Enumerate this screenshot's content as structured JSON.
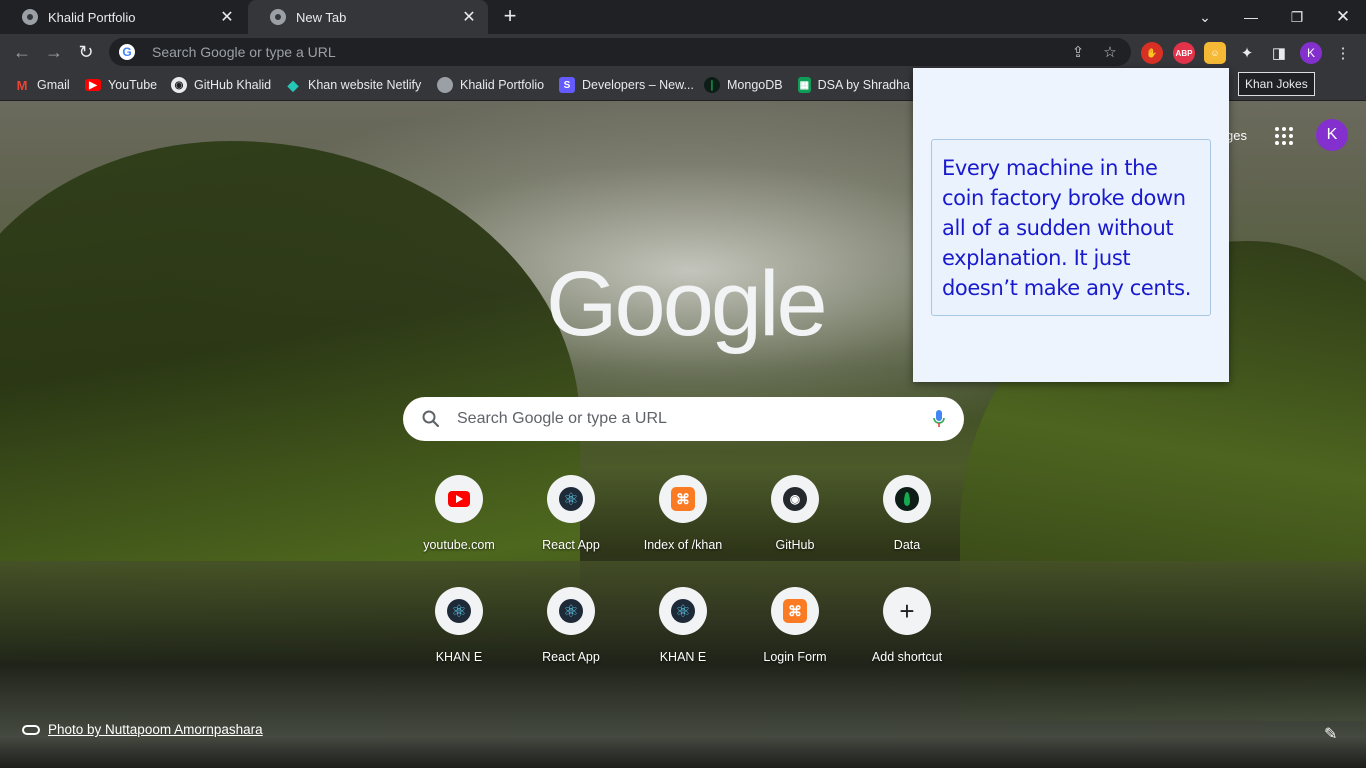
{
  "tabs": [
    {
      "title": "Khalid Portfolio",
      "active": false
    },
    {
      "title": "New Tab",
      "active": true
    }
  ],
  "omnibox": {
    "placeholder": "Search Google or type a URL"
  },
  "extensions": {
    "abp_label": "ABP",
    "profile_initial": "K",
    "hovered_tooltip": "Khan Jokes"
  },
  "bookmarks": [
    {
      "label": "Gmail",
      "icon": "gmail-icon"
    },
    {
      "label": "YouTube",
      "icon": "youtube-icon"
    },
    {
      "label": "GitHub Khalid",
      "icon": "github-icon"
    },
    {
      "label": "Khan website Netlify",
      "icon": "netlify-icon"
    },
    {
      "label": "Khalid Portfolio",
      "icon": "globe-icon"
    },
    {
      "label": "Developers – New...",
      "icon": "stripe-icon"
    },
    {
      "label": "MongoDB",
      "icon": "mongodb-icon"
    },
    {
      "label": "DSA by Shradha",
      "icon": "sheets-icon"
    }
  ],
  "ntp": {
    "top_link_partial": "ges",
    "avatar_initial": "K",
    "logo": "Google",
    "search_placeholder": "Search Google or type a URL",
    "shortcuts": [
      {
        "label": "youtube.com",
        "icon": "youtube-icon"
      },
      {
        "label": "React App",
        "icon": "react-icon"
      },
      {
        "label": "Index of /khan",
        "icon": "xampp-icon"
      },
      {
        "label": "GitHub",
        "icon": "github-icon"
      },
      {
        "label": "Data",
        "icon": "mongodb-icon"
      },
      {
        "label": "KHAN E",
        "icon": "react-icon"
      },
      {
        "label": "React App",
        "icon": "react-icon"
      },
      {
        "label": "KHAN E",
        "icon": "react-icon"
      },
      {
        "label": "Login Form",
        "icon": "xampp-icon"
      },
      {
        "label": "Add shortcut",
        "icon": "plus-icon"
      }
    ],
    "photo_credit": "Photo by Nuttapoom Amornpashara"
  },
  "popup": {
    "joke": "Every machine in the coin factory broke down all of a sudden without explanation. It just doesn’t make any cents."
  },
  "colors": {
    "chrome_dark": "#202124",
    "toolbar": "#35363a",
    "popup_bg": "#eef4fd",
    "joke_text": "#1a1acd",
    "avatar": "#8430ce"
  }
}
